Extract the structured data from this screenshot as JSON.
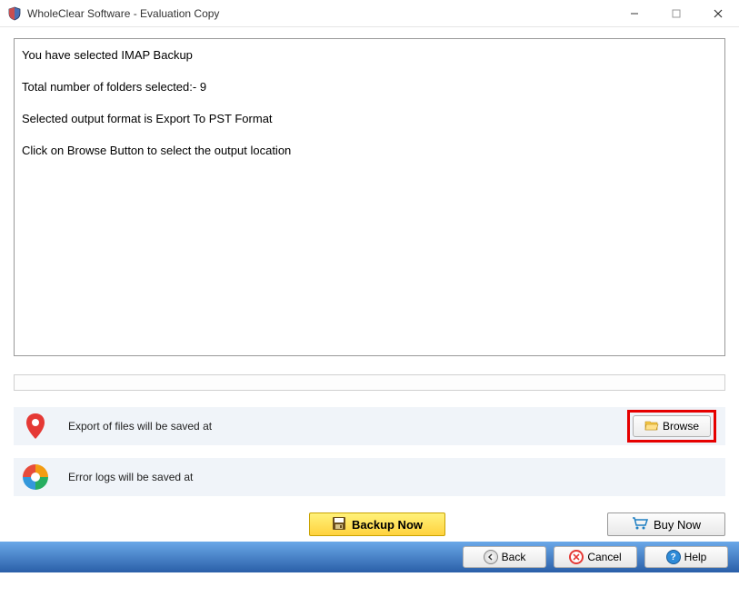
{
  "window": {
    "title": "WholeClear Software - Evaluation Copy"
  },
  "info": {
    "line1": "You have selected IMAP Backup",
    "line2": "Total number of folders selected:- 9",
    "line3": "Selected output format is Export To PST Format",
    "line4": "Click on Browse Button to select the output location"
  },
  "rows": {
    "export_label": "Export of files will be saved at",
    "error_label": "Error logs will be saved at",
    "browse_label": "Browse"
  },
  "actions": {
    "backup": "Backup Now",
    "buy": "Buy Now"
  },
  "footer": {
    "back": "Back",
    "cancel": "Cancel",
    "help": "Help"
  }
}
